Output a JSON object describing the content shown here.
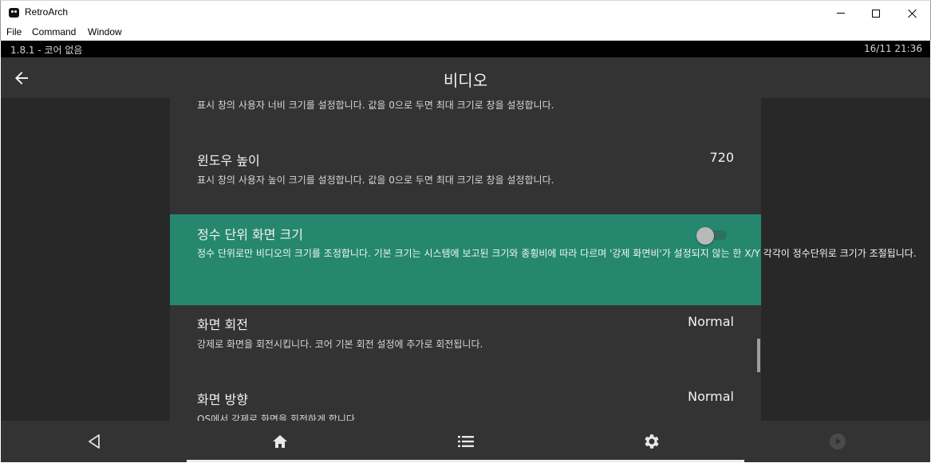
{
  "window": {
    "title": "RetroArch",
    "menu": [
      "File",
      "Command",
      "Window"
    ]
  },
  "status": {
    "left": "1.8.1 - 코어 없음",
    "right": "16/11 21:36"
  },
  "header": {
    "title": "비디오",
    "back_icon": "arrow-left-icon"
  },
  "entries": {
    "width_desc": "표시 창의 사용자 너비 크기를 설정합니다. 값을 0으로 두면 최대 크기로 창을 설정합니다.",
    "height": {
      "label": "윈도우 높이",
      "value": "720",
      "desc": "표시 창의 사용자 높이 크기를 설정합니다. 값을 0으로 두면 최대 크기로 창을 설정합니다."
    },
    "integer_scale": {
      "label": "정수 단위 화면 크기",
      "desc": "정수 단위로만 비디오의 크기를 조정합니다. 기본 크기는 시스템에 보고된 크기와 종횡비에 따라 다르며 '강제 화면비'가 설정되지 않는 한 X/Y 각각이 정수단위로 크기가 조절됩니다.",
      "enabled": false
    },
    "rotation": {
      "label": "화면 회전",
      "value": "Normal",
      "desc": "강제로 화면을 회전시킵니다. 코어 기본 회전 설정에 추가로 회전됩니다."
    },
    "orientation": {
      "label": "화면 방향",
      "value": "Normal",
      "desc": "OS에서 강제로 화면을 회전하게 합니다."
    }
  },
  "bottom_tabs": [
    "back-triangle-icon",
    "home-icon",
    "list-icon",
    "settings-gear-icon",
    "play-circle-icon"
  ],
  "colors": {
    "accent": "#26876f",
    "panel": "#333333",
    "background": "#282828"
  }
}
